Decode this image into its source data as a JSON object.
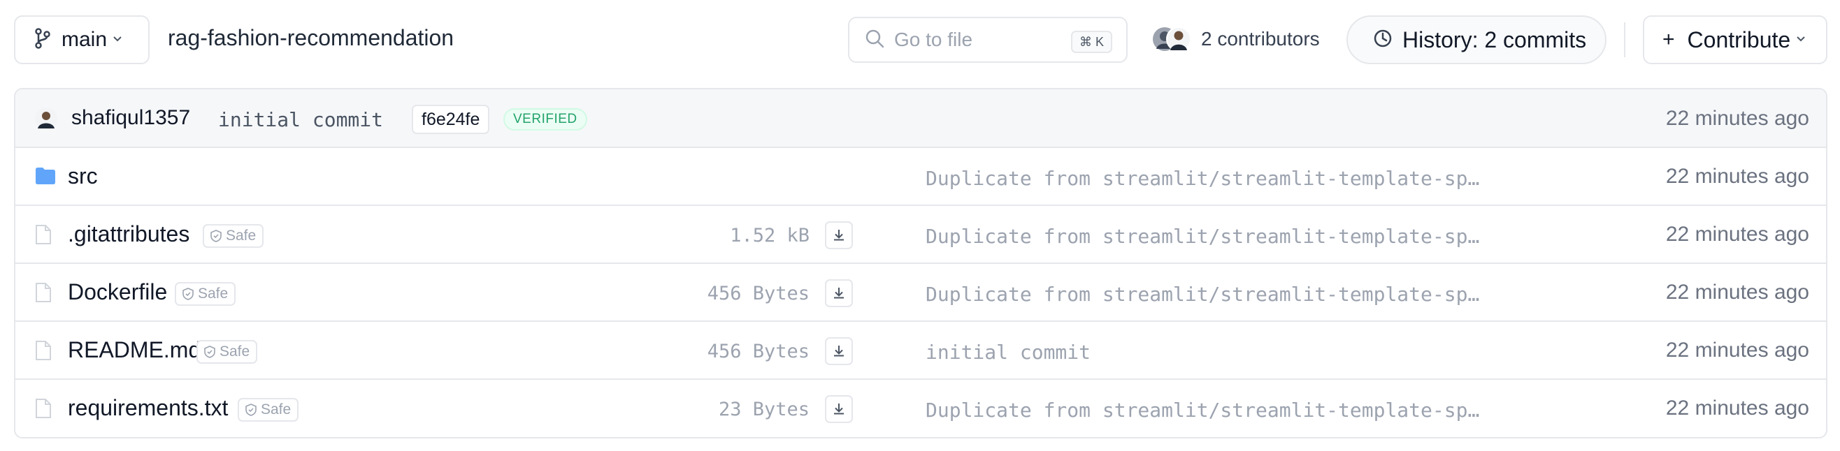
{
  "header": {
    "branch": "main",
    "repo_name": "rag-fashion-recommendation",
    "search_placeholder": "Go to file",
    "search_shortcut": "⌘ K",
    "contributors_label": "2 contributors",
    "history_label": "History: 2 commits",
    "contribute_label": "Contribute"
  },
  "last_commit": {
    "author": "shafiqul1357",
    "message": "initial commit",
    "hash": "f6e24fe",
    "verified_label": "VERIFIED",
    "time": "22 minutes ago"
  },
  "files": [
    {
      "type": "folder",
      "name": "src",
      "safe_label": "",
      "size": "",
      "commit_message": "Duplicate from streamlit/streamlit-template-sp…",
      "time": "22 minutes ago"
    },
    {
      "type": "file",
      "name": ".gitattributes",
      "safe_label": "Safe",
      "size": "1.52 kB",
      "commit_message": "Duplicate from streamlit/streamlit-template-sp…",
      "time": "22 minutes ago"
    },
    {
      "type": "file",
      "name": "Dockerfile",
      "safe_label": "Safe",
      "size": "456 Bytes",
      "commit_message": "Duplicate from streamlit/streamlit-template-sp…",
      "time": "22 minutes ago"
    },
    {
      "type": "file",
      "name": "README.md",
      "safe_label": "Safe",
      "size": "456 Bytes",
      "commit_message": "initial commit",
      "time": "22 minutes ago"
    },
    {
      "type": "file",
      "name": "requirements.txt",
      "safe_label": "Safe",
      "size": "23 Bytes",
      "commit_message": "Duplicate from streamlit/streamlit-template-sp…",
      "time": "22 minutes ago"
    }
  ],
  "colors": {
    "folder": "#60a5fa",
    "verified_text": "#22a36a",
    "muted_text": "#9ca3af",
    "border": "#e5e7eb"
  },
  "icons": {
    "branch": "git-branch-icon",
    "search": "search-icon",
    "history": "clock-icon",
    "folder": "folder-icon",
    "file": "file-icon",
    "safe": "shield-check-icon",
    "download": "download-icon"
  }
}
